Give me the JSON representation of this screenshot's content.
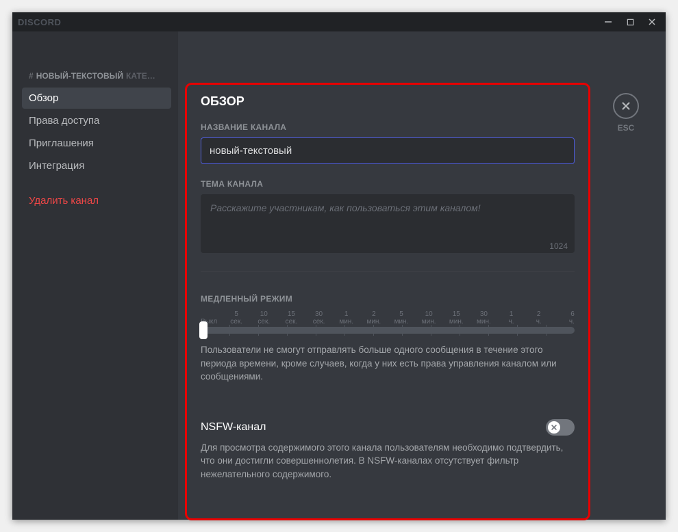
{
  "window": {
    "brand": "DISCORD"
  },
  "sidebar": {
    "channel_prefix": "НОВЫЙ-ТЕКСТОВЫЙ",
    "channel_category": "КАТЕ…",
    "items": [
      {
        "label": "Обзор"
      },
      {
        "label": "Права доступа"
      },
      {
        "label": "Приглашения"
      },
      {
        "label": "Интеграция"
      }
    ],
    "delete_label": "Удалить канал"
  },
  "esc": {
    "label": "ESC"
  },
  "overview": {
    "title": "ОБЗОР",
    "name_label": "НАЗВАНИЕ КАНАЛА",
    "name_value": "новый-текстовый",
    "topic_label": "ТЕМА КАНАЛА",
    "topic_placeholder": "Расскажите участникам, как пользоваться этим каналом!",
    "topic_charlimit": "1024",
    "slowmode_label": "МЕДЛЕННЫЙ РЕЖИМ",
    "slowmode_ticks": [
      "Выкл",
      "5 сек.",
      "10 сек.",
      "15 сек.",
      "30 сек.",
      "1 мин.",
      "2 мин.",
      "5 мин.",
      "10 мин.",
      "15 мин.",
      "30 мин.",
      "1 ч.",
      "2 ч.",
      "6 ч."
    ],
    "slowmode_help": "Пользователи не смогут отправлять больше одного сообщения в течение этого периода времени, кроме случаев, когда у них есть права управления каналом или сообщениями.",
    "nsfw_title": "NSFW-канал",
    "nsfw_help": "Для просмотра содержимого этого канала пользователям необходимо подтвердить, что они достигли совершеннолетия. В NSFW-каналах отсутствует фильтр нежелательного содержимого.",
    "nsfw_enabled": false
  }
}
